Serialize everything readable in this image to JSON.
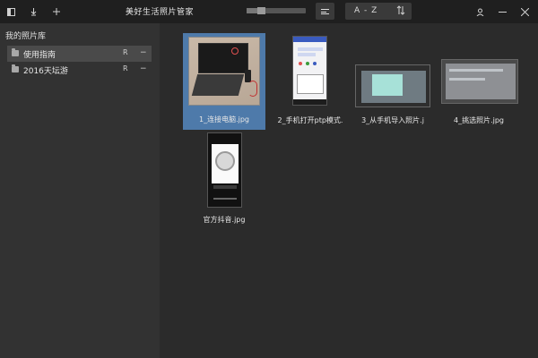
{
  "window": {
    "title": "美好生活照片管家",
    "toolbar": {
      "icons": [
        "sidebar-toggle-icon",
        "import-icon",
        "add-icon"
      ],
      "zoom_fraction": 0.25,
      "sort_field": "A - Z",
      "sort_direction_icon": "sort-direction-icon"
    },
    "controls": {
      "icons": [
        "user-icon",
        "minimize-icon",
        "close-icon"
      ]
    }
  },
  "sidebar": {
    "header": "我的照片库",
    "items": [
      {
        "label": "使用指南",
        "badge": "R",
        "action": "−",
        "selected": true
      },
      {
        "label": "2016天坛游",
        "badge": "R",
        "action": "−",
        "selected": false
      }
    ]
  },
  "photos": [
    {
      "caption": "1_连接电脑.jpg",
      "selected": true
    },
    {
      "caption": "2_手机打开ptp模式.",
      "selected": false
    },
    {
      "caption": "3_从手机导入照片.j",
      "selected": false
    },
    {
      "caption": "4_挑选照片.jpg",
      "selected": false
    },
    {
      "caption": "官方抖音.jpg",
      "selected": false
    }
  ],
  "colors": {
    "titlebar": "#1f1f1f",
    "sidebar": "#323232",
    "main": "#2b2b2b",
    "selection": "#4e7aaa"
  }
}
